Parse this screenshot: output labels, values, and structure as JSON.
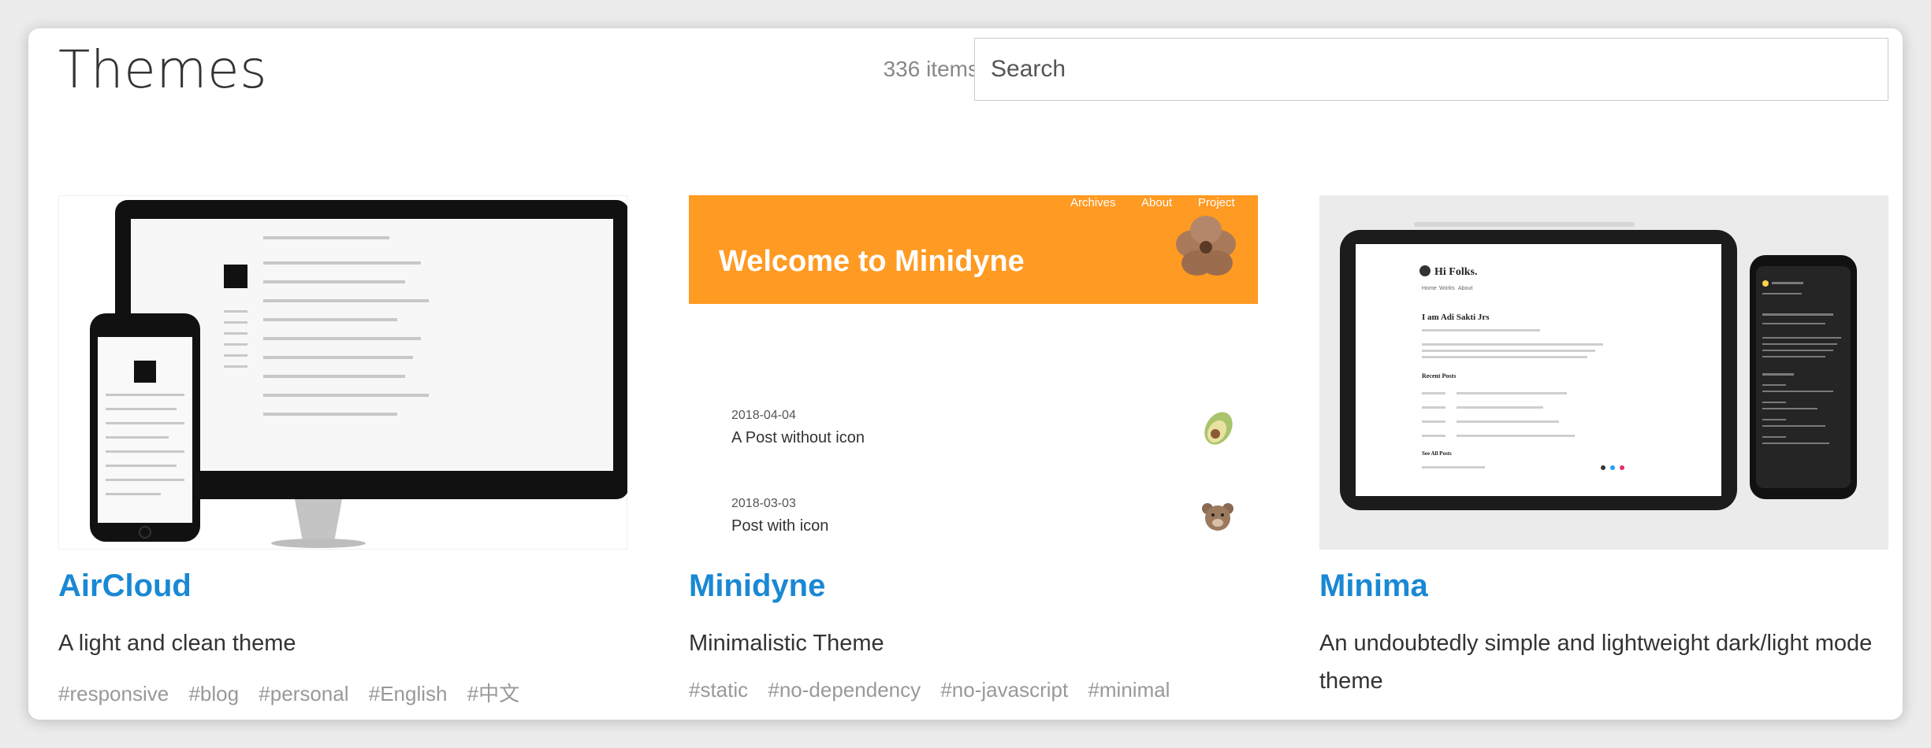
{
  "header": {
    "title": "Themes",
    "count_label": "336 items",
    "search_placeholder": "Search"
  },
  "cards": [
    {
      "title": "AirCloud",
      "description": "A light and clean theme",
      "tags": [
        "#responsive",
        "#blog",
        "#personal",
        "#English",
        "#中文"
      ]
    },
    {
      "title": "Minidyne",
      "description": "Minimalistic Theme",
      "tags": [
        "#static",
        "#no-dependency",
        "#no-javascript",
        "#minimal"
      ],
      "preview": {
        "nav": [
          "Archives",
          "About",
          "Project"
        ],
        "banner": "Welcome to Minidyne",
        "posts": [
          {
            "date": "2018-04-04",
            "title": "A Post without icon"
          },
          {
            "date": "2018-03-03",
            "title": "Post with icon"
          }
        ]
      }
    },
    {
      "title": "Minima",
      "description": "An undoubtedly simple and lightweight dark/light mode theme",
      "tags": [],
      "preview": {
        "greeting": "Hi Folks.",
        "nav": [
          "Home",
          "Works",
          "About"
        ],
        "heading": "I am Adi Sakti Jrs",
        "section": "Recent Posts",
        "see_all": "See All Posts"
      }
    }
  ],
  "colors": {
    "link_blue": "#1a88d4",
    "banner_orange": "#ff9a22",
    "tag_gray": "#999999"
  }
}
